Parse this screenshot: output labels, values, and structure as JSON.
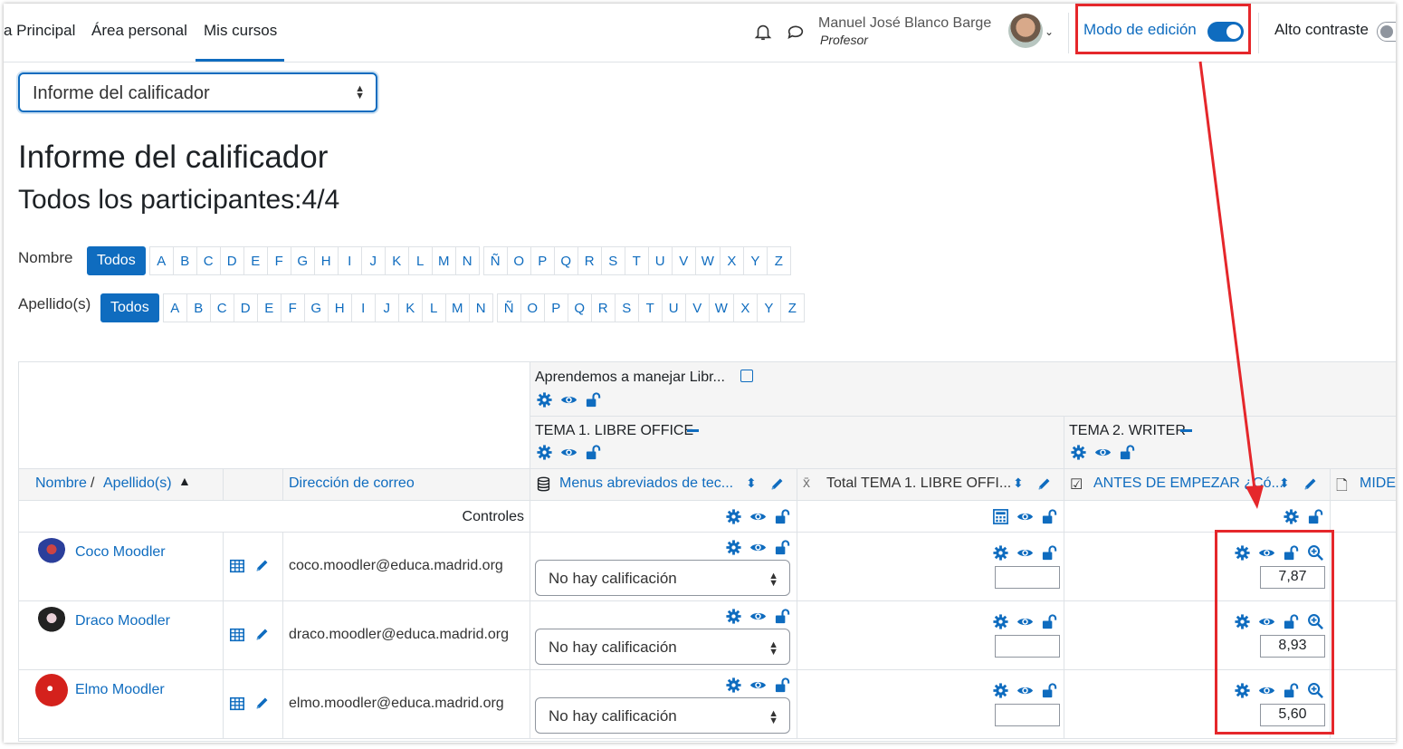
{
  "navbar": {
    "links": [
      "a Principal",
      "Área personal",
      "Mis cursos"
    ],
    "user_name": "Manuel José Blanco Barge",
    "user_role": "Profesor",
    "edit_mode_label": "Modo de edición",
    "contrast_label": "Alto contraste"
  },
  "report_select": {
    "value": "Informe del calificador"
  },
  "page": {
    "title": "Informe del calificador",
    "subtitle": "Todos los participantes:4/4"
  },
  "initials": {
    "first_label": "Nombre",
    "last_label": "Apellido(s)",
    "all_label": "Todos",
    "letters": [
      "A",
      "B",
      "C",
      "D",
      "E",
      "F",
      "G",
      "H",
      "I",
      "J",
      "K",
      "L",
      "M",
      "N",
      "Ñ",
      "O",
      "P",
      "Q",
      "R",
      "S",
      "T",
      "U",
      "V",
      "W",
      "X",
      "Y",
      "Z"
    ]
  },
  "table": {
    "course_category": "Aprendemos a manejar Libr...",
    "categories": [
      "TEMA 1. LIBRE OFFICE",
      "TEMA 2. WRITER"
    ],
    "header_name": "Nombre",
    "header_sep": " / ",
    "header_surname": "Apellido(s)",
    "header_email": "Dirección de correo",
    "columns": [
      "Menus abreviados de tec...",
      "Total TEMA 1. LIBRE OFFI...",
      "ANTES DE EMPEZAR ¿Có...",
      "MIDE"
    ],
    "controls_label": "Controles",
    "students": [
      {
        "name": "Coco Moodler",
        "email": "coco.moodler@educa.madrid.org",
        "select_value": "No hay calificación",
        "total": "",
        "grade": "7,87"
      },
      {
        "name": "Draco Moodler",
        "email": "draco.moodler@educa.madrid.org",
        "select_value": "No hay calificación",
        "total": "",
        "grade": "8,93"
      },
      {
        "name": "Elmo Moodler",
        "email": "elmo.moodler@educa.madrid.org",
        "select_value": "No hay calificación",
        "total": "",
        "grade": "5,60"
      }
    ]
  },
  "colors": {
    "primary": "#0f6cbf",
    "annotation": "#e5272b"
  },
  "icons": [
    "bell-icon",
    "chat-icon",
    "gear-icon",
    "eye-icon",
    "unlock-icon",
    "zoom-icon",
    "pencil-icon",
    "table-icon",
    "calculator-icon",
    "quiz-icon",
    "assign-icon",
    "database-icon",
    "sigma-icon"
  ]
}
